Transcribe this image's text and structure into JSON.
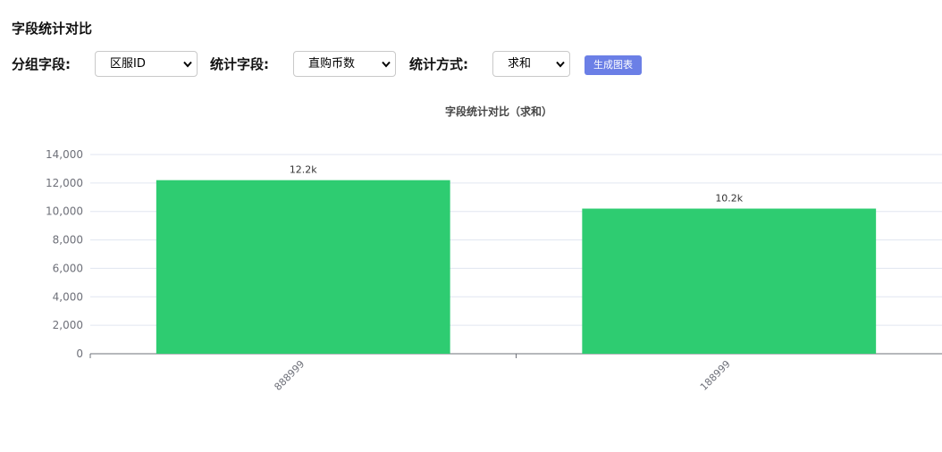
{
  "page": {
    "title": "字段统计对比"
  },
  "controls": {
    "group_label": "分组字段:",
    "group_value": "区服ID",
    "field_label": "统计字段:",
    "field_value": "直购币数",
    "method_label": "统计方式:",
    "method_value": "求和",
    "generate_label": "生成图表",
    "accent_color": "#6b7fe6"
  },
  "chart_data": {
    "type": "bar",
    "title": "字段统计对比（求和）",
    "categories": [
      "888999",
      "188999"
    ],
    "values": [
      12200,
      10200
    ],
    "value_labels": [
      "12.2k",
      "10.2k"
    ],
    "ylim": [
      0,
      14000
    ],
    "yticks": [
      0,
      2000,
      4000,
      6000,
      8000,
      10000,
      12000,
      14000
    ],
    "ytick_labels": [
      "0",
      "2,000",
      "4,000",
      "6,000",
      "8,000",
      "10,000",
      "12,000",
      "14,000"
    ],
    "xlabel": "",
    "ylabel": "",
    "grid": true,
    "bar_color": "#2ecc71"
  }
}
